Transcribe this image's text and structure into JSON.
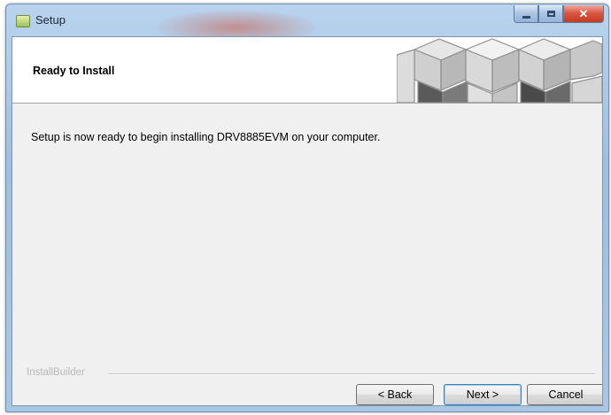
{
  "window": {
    "title": "Setup",
    "close_glyph": "✕",
    "app_icon": "setup-app-icon"
  },
  "header": {
    "title": "Ready to Install",
    "logo_icon": "cube-logo"
  },
  "main": {
    "message": "Setup is now ready to begin installing DRV8885EVM on your computer."
  },
  "footer": {
    "brand": "InstallBuilder",
    "buttons": {
      "back": "< Back",
      "next": "Next >",
      "cancel": "Cancel"
    }
  }
}
